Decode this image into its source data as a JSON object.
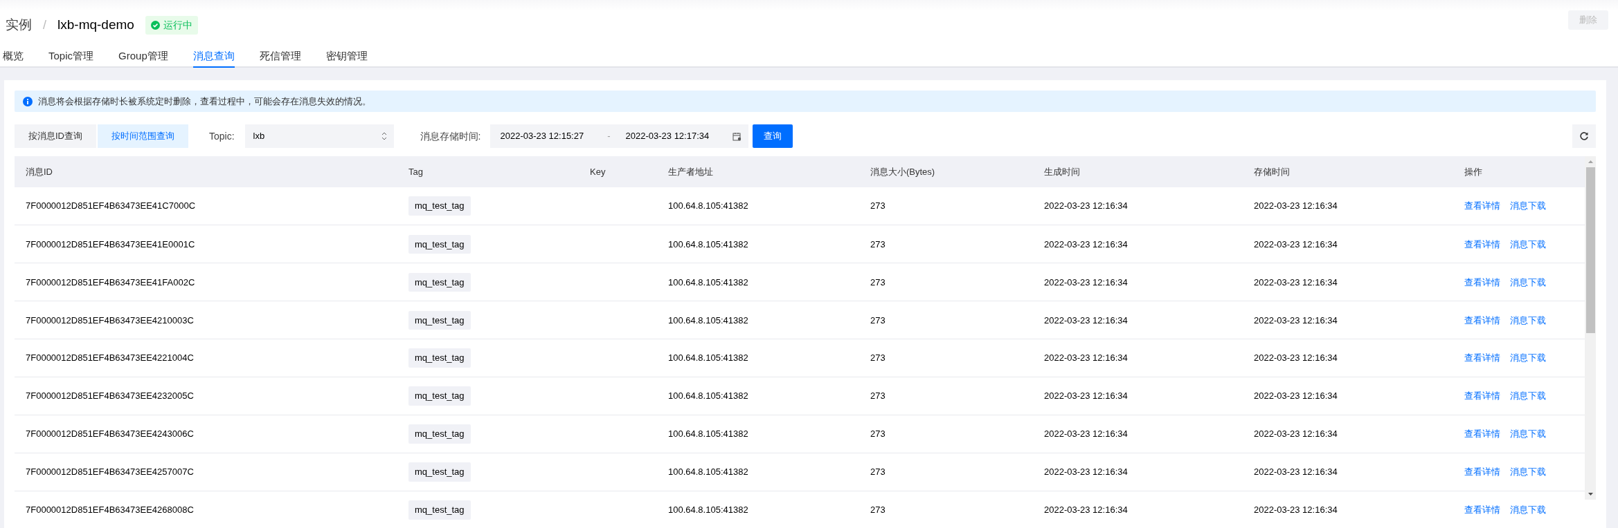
{
  "breadcrumb": {
    "root": "实例",
    "separator": "/",
    "instance": "lxb-mq-demo",
    "status": "运行中"
  },
  "delete_button": {
    "label": "删除",
    "disabled": true
  },
  "tabs": [
    {
      "label": "概览",
      "selected": false
    },
    {
      "label": "Topic管理",
      "selected": false
    },
    {
      "label": "Group管理",
      "selected": false
    },
    {
      "label": "消息查询",
      "selected": true
    },
    {
      "label": "死信管理",
      "selected": false
    },
    {
      "label": "密钥管理",
      "selected": false
    }
  ],
  "notice": "消息将会根据存储时长被系统定时删除，查看过程中，可能会存在消息失效的情况。",
  "query_modes": [
    {
      "label": "按消息ID查询",
      "selected": false
    },
    {
      "label": "按时间范围查询",
      "selected": true
    }
  ],
  "topic": {
    "label": "Topic:",
    "value": "lxb"
  },
  "time_range": {
    "label": "消息存储时间:",
    "start": "2022-03-23 12:15:27",
    "separator": "-",
    "end": "2022-03-23 12:17:34"
  },
  "query_button": "查询",
  "table": {
    "columns": [
      "消息ID",
      "Tag",
      "Key",
      "生产者地址",
      "消息大小(Bytes)",
      "生成时间",
      "存储时间",
      "操作"
    ],
    "rows": [
      {
        "id": "7F0000012D851EF4B63473EE41C7000C",
        "tag": "mq_test_tag",
        "key": "",
        "producer": "100.64.8.105:41382",
        "size": "273",
        "created": "2022-03-23 12:16:34",
        "stored": "2022-03-23 12:16:34",
        "actions": [
          "查看详情",
          "消息下载"
        ]
      },
      {
        "id": "7F0000012D851EF4B63473EE41E0001C",
        "tag": "mq_test_tag",
        "key": "",
        "producer": "100.64.8.105:41382",
        "size": "273",
        "created": "2022-03-23 12:16:34",
        "stored": "2022-03-23 12:16:34",
        "actions": [
          "查看详情",
          "消息下载"
        ]
      },
      {
        "id": "7F0000012D851EF4B63473EE41FA002C",
        "tag": "mq_test_tag",
        "key": "",
        "producer": "100.64.8.105:41382",
        "size": "273",
        "created": "2022-03-23 12:16:34",
        "stored": "2022-03-23 12:16:34",
        "actions": [
          "查看详情",
          "消息下载"
        ]
      },
      {
        "id": "7F0000012D851EF4B63473EE4210003C",
        "tag": "mq_test_tag",
        "key": "",
        "producer": "100.64.8.105:41382",
        "size": "273",
        "created": "2022-03-23 12:16:34",
        "stored": "2022-03-23 12:16:34",
        "actions": [
          "查看详情",
          "消息下载"
        ]
      },
      {
        "id": "7F0000012D851EF4B63473EE4221004C",
        "tag": "mq_test_tag",
        "key": "",
        "producer": "100.64.8.105:41382",
        "size": "273",
        "created": "2022-03-23 12:16:34",
        "stored": "2022-03-23 12:16:34",
        "actions": [
          "查看详情",
          "消息下载"
        ]
      },
      {
        "id": "7F0000012D851EF4B63473EE4232005C",
        "tag": "mq_test_tag",
        "key": "",
        "producer": "100.64.8.105:41382",
        "size": "273",
        "created": "2022-03-23 12:16:34",
        "stored": "2022-03-23 12:16:34",
        "actions": [
          "查看详情",
          "消息下载"
        ]
      },
      {
        "id": "7F0000012D851EF4B63473EE4243006C",
        "tag": "mq_test_tag",
        "key": "",
        "producer": "100.64.8.105:41382",
        "size": "273",
        "created": "2022-03-23 12:16:34",
        "stored": "2022-03-23 12:16:34",
        "actions": [
          "查看详情",
          "消息下载"
        ]
      },
      {
        "id": "7F0000012D851EF4B63473EE4257007C",
        "tag": "mq_test_tag",
        "key": "",
        "producer": "100.64.8.105:41382",
        "size": "273",
        "created": "2022-03-23 12:16:34",
        "stored": "2022-03-23 12:16:34",
        "actions": [
          "查看详情",
          "消息下载"
        ]
      },
      {
        "id": "7F0000012D851EF4B63473EE4268008C",
        "tag": "mq_test_tag",
        "key": "",
        "producer": "100.64.8.105:41382",
        "size": "273",
        "created": "2022-03-23 12:16:34",
        "stored": "2022-03-23 12:16:34",
        "actions": [
          "查看详情",
          "消息下载"
        ]
      }
    ]
  }
}
